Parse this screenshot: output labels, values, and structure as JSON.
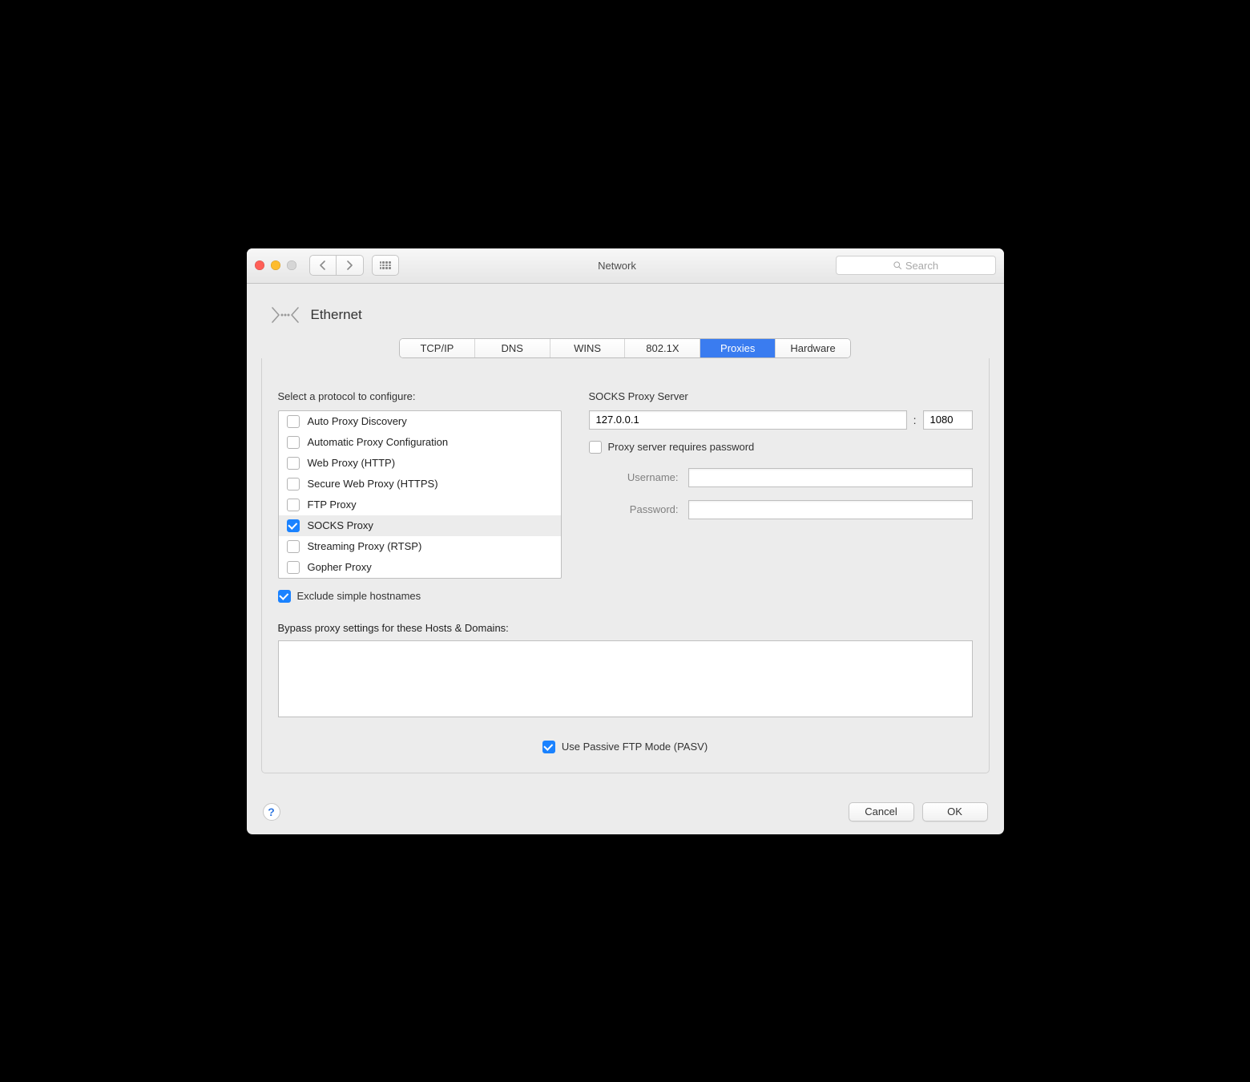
{
  "window": {
    "title": "Network"
  },
  "toolbar": {
    "search_placeholder": "Search"
  },
  "header": {
    "interface": "Ethernet"
  },
  "tabs": {
    "items": [
      "TCP/IP",
      "DNS",
      "WINS",
      "802.1X",
      "Proxies",
      "Hardware"
    ],
    "active_index": 4
  },
  "proxies": {
    "select_label": "Select a protocol to configure:",
    "protocols": [
      {
        "label": "Auto Proxy Discovery",
        "checked": false,
        "selected": false
      },
      {
        "label": "Automatic Proxy Configuration",
        "checked": false,
        "selected": false
      },
      {
        "label": "Web Proxy (HTTP)",
        "checked": false,
        "selected": false
      },
      {
        "label": "Secure Web Proxy (HTTPS)",
        "checked": false,
        "selected": false
      },
      {
        "label": "FTP Proxy",
        "checked": false,
        "selected": false
      },
      {
        "label": "SOCKS Proxy",
        "checked": true,
        "selected": true
      },
      {
        "label": "Streaming Proxy (RTSP)",
        "checked": false,
        "selected": false
      },
      {
        "label": "Gopher Proxy",
        "checked": false,
        "selected": false
      }
    ],
    "server_label": "SOCKS Proxy Server",
    "server_host": "127.0.0.1",
    "server_port": "1080",
    "requires_password_label": "Proxy server requires password",
    "requires_password_checked": false,
    "username_label": "Username:",
    "username_value": "",
    "password_label": "Password:",
    "password_value": "",
    "exclude_simple_label": "Exclude simple hostnames",
    "exclude_simple_checked": true,
    "bypass_label": "Bypass proxy settings for these Hosts & Domains:",
    "bypass_value": "",
    "pasv_label": "Use Passive FTP Mode (PASV)",
    "pasv_checked": true
  },
  "footer": {
    "cancel": "Cancel",
    "ok": "OK"
  }
}
